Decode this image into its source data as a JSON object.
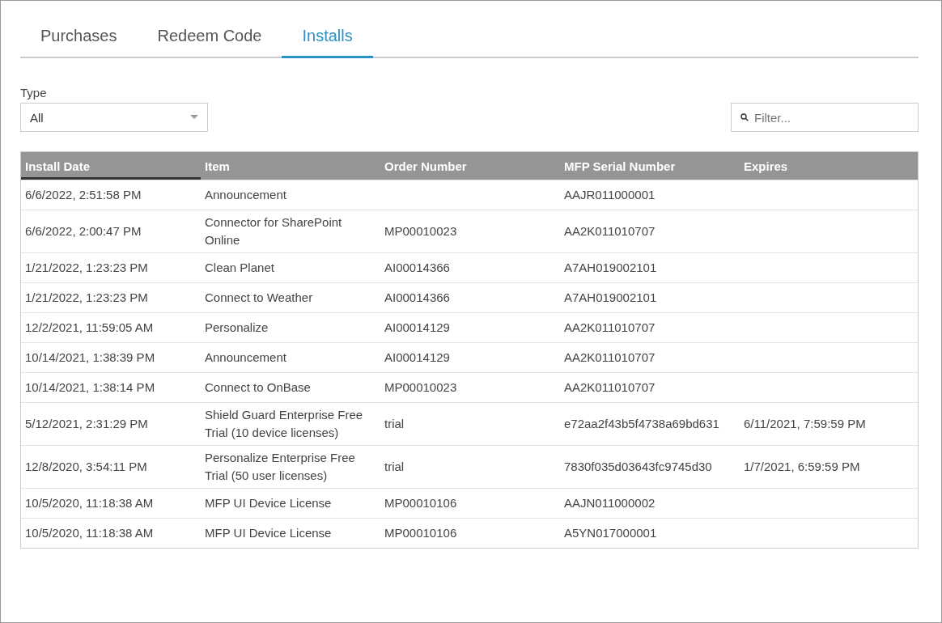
{
  "tabs": [
    {
      "label": "Purchases",
      "selected": false
    },
    {
      "label": "Redeem Code",
      "selected": false
    },
    {
      "label": "Installs",
      "selected": true
    }
  ],
  "type_filter": {
    "label": "Type",
    "value": "All"
  },
  "filter": {
    "placeholder": "Filter..."
  },
  "table": {
    "columns": [
      {
        "label": "Install Date",
        "sorted": true
      },
      {
        "label": "Item",
        "sorted": false
      },
      {
        "label": "Order Number",
        "sorted": false
      },
      {
        "label": "MFP Serial Number",
        "sorted": false
      },
      {
        "label": "Expires",
        "sorted": false
      }
    ],
    "rows": [
      [
        "6/6/2022, 2:51:58 PM",
        "Announcement",
        "",
        "AAJR011000001",
        ""
      ],
      [
        "6/6/2022, 2:00:47 PM",
        "Connector for SharePoint Online",
        "MP00010023",
        "AA2K011010707",
        ""
      ],
      [
        "1/21/2022, 1:23:23 PM",
        "Clean Planet",
        "AI00014366",
        "A7AH019002101",
        ""
      ],
      [
        "1/21/2022, 1:23:23 PM",
        "Connect to Weather",
        "AI00014366",
        "A7AH019002101",
        ""
      ],
      [
        "12/2/2021, 11:59:05 AM",
        "Personalize",
        "AI00014129",
        "AA2K011010707",
        ""
      ],
      [
        "10/14/2021, 1:38:39 PM",
        "Announcement",
        "AI00014129",
        "AA2K011010707",
        ""
      ],
      [
        "10/14/2021, 1:38:14 PM",
        "Connect to OnBase",
        "MP00010023",
        "AA2K011010707",
        ""
      ],
      [
        "5/12/2021, 2:31:29 PM",
        "Shield Guard Enterprise Free Trial (10 device licenses)",
        "trial",
        "e72aa2f43b5f4738a69bd631",
        "6/11/2021, 7:59:59 PM"
      ],
      [
        "12/8/2020, 3:54:11 PM",
        "Personalize Enterprise Free Trial (50 user licenses)",
        "trial",
        "7830f035d03643fc9745d30",
        "1/7/2021, 6:59:59 PM"
      ],
      [
        "10/5/2020, 11:18:38 AM",
        "MFP UI Device License",
        "MP00010106",
        "AAJN011000002",
        ""
      ],
      [
        "10/5/2020, 11:18:38 AM",
        "MFP UI Device License",
        "MP00010106",
        "A5YN017000001",
        ""
      ]
    ]
  }
}
